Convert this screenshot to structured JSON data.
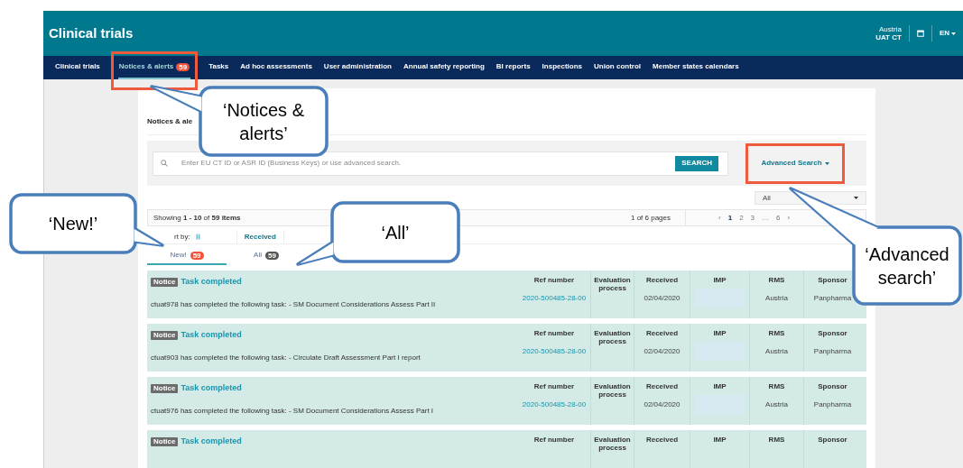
{
  "header": {
    "title": "Clinical trials",
    "country": "Austria",
    "role": "UAT CT",
    "language": "EN"
  },
  "nav": [
    {
      "label": "Clinical trials",
      "selected": false
    },
    {
      "label": "Notices & alerts",
      "selected": true,
      "badge": "59"
    },
    {
      "label": "Tasks",
      "selected": false
    },
    {
      "label": "Ad hoc assessments",
      "selected": false
    },
    {
      "label": "User administration",
      "selected": false
    },
    {
      "label": "Annual safety reporting",
      "selected": false
    },
    {
      "label": "BI reports",
      "selected": false
    },
    {
      "label": "Inspections",
      "selected": false
    },
    {
      "label": "Union control",
      "selected": false
    },
    {
      "label": "Member states calendars",
      "selected": false
    }
  ],
  "page": {
    "heading": "Notices & ale"
  },
  "search": {
    "placeholder": "Enter EU CT ID or ASR ID (Business Keys) or use advanced search.",
    "button": "SEARCH",
    "advanced": "Advanced Search"
  },
  "filter": {
    "value": "All"
  },
  "pagination": {
    "showing": "Showing **1 - 10** of **59 items**",
    "pages": "1 of 6 pages",
    "links": [
      {
        "label": "‹",
        "selected": false
      },
      {
        "label": "1",
        "selected": true
      },
      {
        "label": "2",
        "selected": false
      },
      {
        "label": "3",
        "selected": false
      },
      {
        "label": "…",
        "selected": false
      },
      {
        "label": "6",
        "selected": false
      },
      {
        "label": "›",
        "selected": false
      }
    ]
  },
  "sort": {
    "label": "rt by:",
    "field": "Received"
  },
  "tabs": [
    {
      "label": "New!",
      "count": "59",
      "selected": true,
      "color": "#f0533a"
    },
    {
      "label": "All",
      "count": "59",
      "selected": false,
      "color": "#555555"
    }
  ],
  "notices": [
    {
      "tag": "Notice",
      "title": "Task completed",
      "message": "ctuat978 has completed the following task: - SM Document Considerations Assess Part II",
      "headers": [
        "Ref number",
        "Evaluation process",
        "Received",
        "IMP",
        "RMS",
        "Sponsor"
      ],
      "ref": "2020-500485-28-00",
      "received": "02/04/2020",
      "rms": "Austria",
      "sponsor": "Panpharma"
    },
    {
      "tag": "Notice",
      "title": "Task completed",
      "message": "ctuat903 has completed the following task: - Circulate Draft Assessment Part I report",
      "headers": [
        "Ref number",
        "Evaluation process",
        "Received",
        "IMP",
        "RMS",
        "Sponsor"
      ],
      "ref": "2020-500485-28-00",
      "received": "02/04/2020",
      "rms": "Austria",
      "sponsor": "Panpharma"
    },
    {
      "tag": "Notice",
      "title": "Task completed",
      "message": "ctuat976 has completed the following task: - SM Document Considerations Assess Part I",
      "headers": [
        "Ref number",
        "Evaluation process",
        "Received",
        "IMP",
        "RMS",
        "Sponsor"
      ],
      "ref": "2020-500485-28-00",
      "received": "02/04/2020",
      "rms": "Austria",
      "sponsor": "Panpharma"
    },
    {
      "tag": "Notice",
      "title": "Task completed",
      "headers": [
        "Ref number",
        "Evaluation process",
        "Received",
        "IMP",
        "RMS",
        "Sponsor"
      ]
    }
  ],
  "callouts": [
    {
      "text": "‘Notices & alerts’"
    },
    {
      "text": "‘New!’"
    },
    {
      "text": "‘All’"
    },
    {
      "text": "‘Advanced search’"
    }
  ]
}
